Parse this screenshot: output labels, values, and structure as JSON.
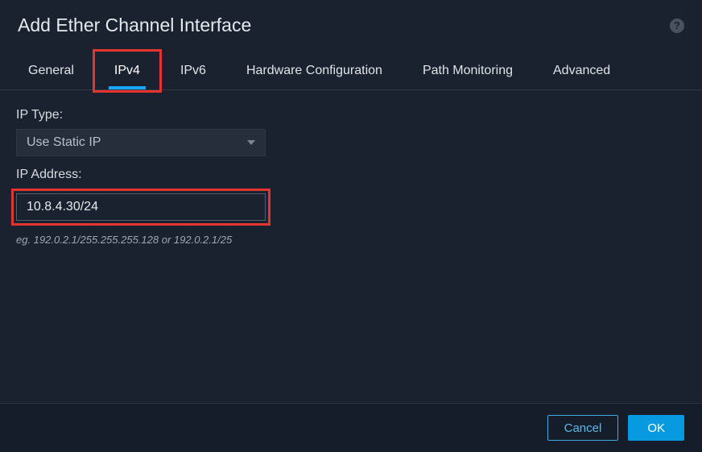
{
  "header": {
    "title": "Add Ether Channel Interface"
  },
  "tabs": {
    "general": "General",
    "ipv4": "IPv4",
    "ipv6": "IPv6",
    "hardware": "Hardware Configuration",
    "path_monitoring": "Path Monitoring",
    "advanced": "Advanced"
  },
  "form": {
    "ip_type_label": "IP Type:",
    "ip_type_value": "Use Static IP",
    "ip_address_label": "IP Address:",
    "ip_address_value": "10.8.4.30/24",
    "ip_address_helper": "eg. 192.0.2.1/255.255.255.128 or 192.0.2.1/25"
  },
  "footer": {
    "cancel": "Cancel",
    "ok": "OK"
  }
}
